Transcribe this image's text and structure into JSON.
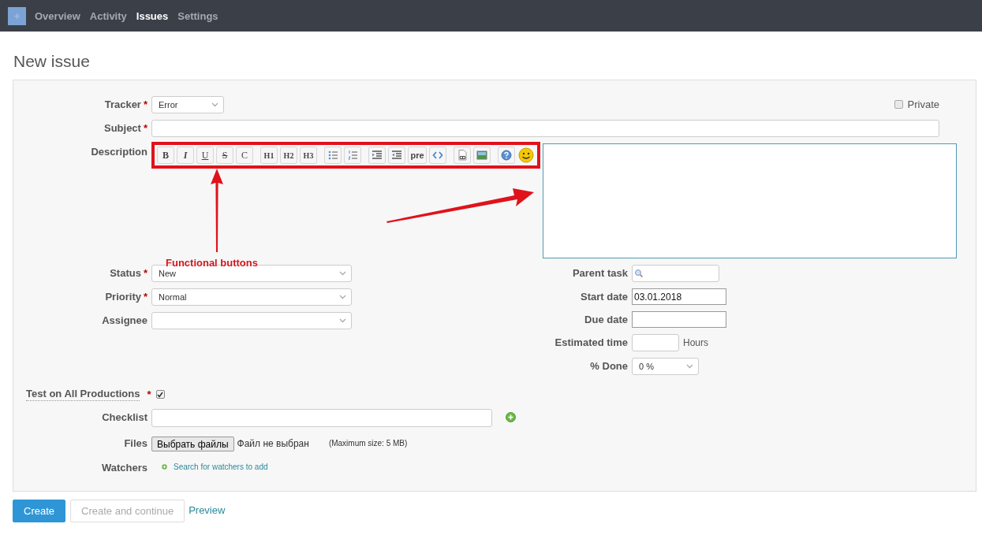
{
  "nav": {
    "items": [
      {
        "label": "Overview",
        "selected": false
      },
      {
        "label": "Activity",
        "selected": false
      },
      {
        "label": "Issues",
        "selected": true
      },
      {
        "label": "Settings",
        "selected": false
      }
    ]
  },
  "title": "New issue",
  "form": {
    "tracker": {
      "label": "Tracker",
      "mark": "*",
      "value": "Error"
    },
    "private": {
      "label": "Private",
      "checked": false
    },
    "subject": {
      "label": "Subject",
      "mark": "*"
    },
    "description": {
      "label": "Description",
      "toolbar": [
        [
          {
            "kind": "bold",
            "text": "B"
          },
          {
            "kind": "italic",
            "text": "I"
          },
          {
            "kind": "underline",
            "text": "U"
          },
          {
            "kind": "strike",
            "text": "S"
          },
          {
            "kind": "plain",
            "text": "C"
          }
        ],
        [
          {
            "kind": "plain",
            "text": "H1"
          },
          {
            "kind": "plain",
            "text": "H2"
          },
          {
            "kind": "plain",
            "text": "H3"
          }
        ],
        [
          {
            "kind": "bullet-list"
          },
          {
            "kind": "number-list"
          }
        ],
        [
          {
            "kind": "indent"
          },
          {
            "kind": "outdent"
          },
          {
            "kind": "plain",
            "text": "pre"
          },
          {
            "kind": "code"
          }
        ],
        [
          {
            "kind": "link"
          },
          {
            "kind": "image"
          }
        ],
        [
          {
            "kind": "help"
          },
          {
            "kind": "smiley"
          }
        ]
      ]
    },
    "left": [
      {
        "label": "Status",
        "mark": "*",
        "value": "New"
      },
      {
        "label": "Priority",
        "mark": "*",
        "value": "Normal"
      },
      {
        "label": "Assignee"
      }
    ],
    "right": [
      {
        "kind": "search",
        "label": "Parent task"
      },
      {
        "kind": "text",
        "label": "Start date",
        "value": "03.01.2018"
      },
      {
        "kind": "text",
        "label": "Due date"
      },
      {
        "kind": "unit",
        "label": "Estimated time",
        "unit": "Hours"
      },
      {
        "kind": "select",
        "label": "% Done",
        "value": "0 %"
      }
    ],
    "test": {
      "label": "Test on All Productions",
      "mark": "*",
      "checked": true
    },
    "checklist": {
      "label": "Checklist"
    },
    "files": {
      "label": "Files",
      "button": "Выбрать файлы",
      "status": "Файл не выбран",
      "note": "(Maximum size: 5 MB)"
    },
    "watchers": {
      "label": "Watchers",
      "link": "Search for watchers to add"
    }
  },
  "actions": {
    "buttons": [
      {
        "label": "Create",
        "kind": "primary"
      },
      {
        "label": "Create and continue",
        "kind": "secondary"
      }
    ],
    "link": "Preview"
  },
  "annotation": {
    "text": "Functional buttons"
  }
}
